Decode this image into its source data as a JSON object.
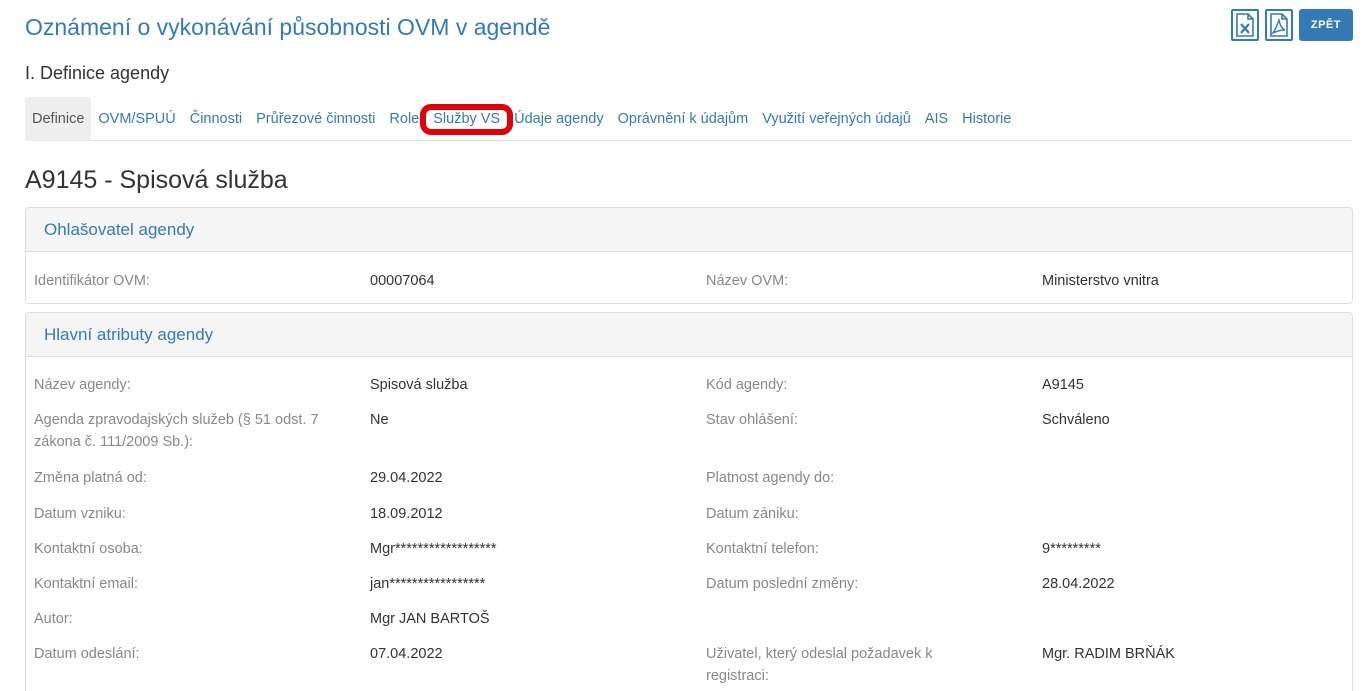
{
  "header": {
    "title": "Oznámení o vykonávání působnosti OVM v agendě",
    "back_label": "ZPĚT",
    "icons": [
      "excel-icon",
      "pdf-icon"
    ]
  },
  "section_heading": "I. Definice agendy",
  "tabs": [
    {
      "label": "Definice",
      "active": true
    },
    {
      "label": "OVM/SPUÚ"
    },
    {
      "label": "Činnosti"
    },
    {
      "label": "Průřezové činnosti"
    },
    {
      "label": "Role"
    },
    {
      "label": "Služby VS",
      "highlighted": true
    },
    {
      "label": "Údaje agendy"
    },
    {
      "label": "Oprávnění k údajům"
    },
    {
      "label": "Využití veřejných údajů"
    },
    {
      "label": "AIS"
    },
    {
      "label": "Historie"
    }
  ],
  "highlight_color": "#e0000a",
  "record_title": "A9145 - Spisová služba",
  "announcer": {
    "heading": "Ohlašovatel agendy",
    "id_label": "Identifikátor OVM:",
    "id_value": "00007064",
    "name_label": "Název OVM:",
    "name_value": "Ministerstvo vnitra"
  },
  "main": {
    "heading": "Hlavní atributy agendy",
    "rows": [
      {
        "l1": "Název agendy:",
        "v1": "Spisová služba",
        "l2": "Kód agendy:",
        "v2": "A9145"
      },
      {
        "l1": "Agenda zpravodajských služeb (§ 51 odst. 7 zákona č. 111/2009 Sb.):",
        "v1": "Ne",
        "l2": "Stav ohlášení:",
        "v2": "Schváleno"
      },
      {
        "l1": "Změna platná od:",
        "v1": "29.04.2022",
        "l2": "Platnost agendy do:",
        "v2": ""
      },
      {
        "l1": "Datum vzniku:",
        "v1": "18.09.2012",
        "l2": "Datum zániku:",
        "v2": ""
      },
      {
        "l1": "Kontaktní osoba:",
        "v1": "Mgr******************",
        "l2": "Kontaktní telefon:",
        "v2": "9*********"
      },
      {
        "l1": "Kontaktní email:",
        "v1": "jan*****************",
        "l2": "Datum poslední změny:",
        "v2": "28.04.2022"
      },
      {
        "l1": "Autor:",
        "v1": "Mgr JAN BARTOŠ",
        "l2": "",
        "v2": ""
      },
      {
        "l1": "Datum odeslání:",
        "v1": "07.04.2022",
        "l2": "Uživatel, který odeslal požadavek k registraci:",
        "v2": "Mgr. RADIM BRŇÁK"
      }
    ]
  }
}
